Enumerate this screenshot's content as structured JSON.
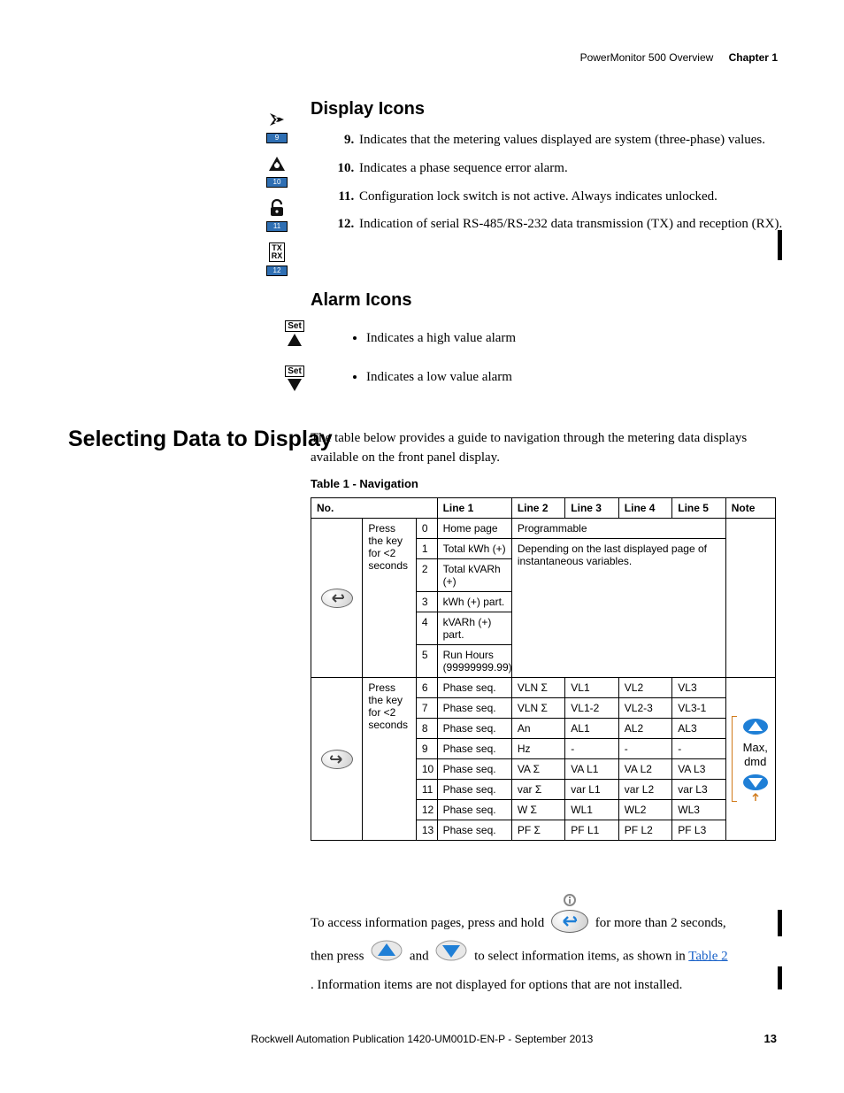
{
  "header": {
    "doc_title": "PowerMonitor 500 Overview",
    "chapter": "Chapter 1"
  },
  "headings": {
    "display_icons": "Display Icons",
    "alarm_icons": "Alarm Icons",
    "selecting": "Selecting Data to Display",
    "table_caption": "Table 1 - Navigation"
  },
  "icon_refs": {
    "n9": "9",
    "n10": "10",
    "n11": "11",
    "n12": "12",
    "tx": "TX",
    "rx": "RX"
  },
  "display_list": {
    "start": 9,
    "items": [
      "Indicates that the metering values displayed are system (three-phase) values.",
      "Indicates a phase sequence error alarm.",
      "Configuration lock switch is not active. Always indicates unlocked.",
      "Indication of serial RS-485/RS-232 data transmission (TX) and reception (RX)."
    ]
  },
  "alarm_set_label": "Set",
  "alarm_list": [
    "Indicates a high value alarm",
    "Indicates a low value alarm"
  ],
  "intro_para": "The table below provides a guide to navigation through the metering data displays available on the front panel display.",
  "table": {
    "headers": {
      "no": "No.",
      "l1": "Line 1",
      "l2": "Line 2",
      "l3": "Line 3",
      "l4": "Line 4",
      "l5": "Line 5",
      "note": "Note"
    },
    "block_a": {
      "press": "Press the key for <2 seconds",
      "rows": [
        {
          "no": "0",
          "l1": "Home page",
          "span": "Programmable",
          "span_cols": 4
        },
        {
          "no": "1",
          "l1": "Total kWh (+)",
          "depending": true
        },
        {
          "no": "2",
          "l1": "Total kVARh (+)",
          "depending": true
        },
        {
          "no": "3",
          "l1": "kWh (+) part.",
          "depending": true
        },
        {
          "no": "4",
          "l1": "kVARh (+) part.",
          "depending": true
        },
        {
          "no": "5",
          "l1": "Run Hours (99999999.99)",
          "depending": true
        }
      ],
      "depending_text": "Depending on the last displayed page of instantaneous variables."
    },
    "block_b": {
      "press": "Press the key for <2 seconds",
      "note_text": "Max, dmd",
      "rows": [
        {
          "no": "6",
          "l1": "Phase seq.",
          "l2": "VLN Σ",
          "l3": "VL1",
          "l4": "VL2",
          "l5": "VL3"
        },
        {
          "no": "7",
          "l1": "Phase seq.",
          "l2": "VLN Σ",
          "l3": "VL1-2",
          "l4": "VL2-3",
          "l5": "VL3-1"
        },
        {
          "no": "8",
          "l1": "Phase seq.",
          "l2": "An",
          "l3": "AL1",
          "l4": "AL2",
          "l5": "AL3"
        },
        {
          "no": "9",
          "l1": "Phase seq.",
          "l2": "Hz",
          "l3": "-",
          "l4": "-",
          "l5": "-"
        },
        {
          "no": "10",
          "l1": "Phase seq.",
          "l2": "VA Σ",
          "l3": "VA L1",
          "l4": "VA L2",
          "l5": "VA L3"
        },
        {
          "no": "11",
          "l1": "Phase seq.",
          "l2": "var Σ",
          "l3": "var L1",
          "l4": "var L2",
          "l5": "var L3"
        },
        {
          "no": "12",
          "l1": "Phase seq.",
          "l2": "W Σ",
          "l3": "WL1",
          "l4": "WL2",
          "l5": "WL3"
        },
        {
          "no": "13",
          "l1": "Phase seq.",
          "l2": "PF Σ",
          "l3": "PF L1",
          "l4": "PF L2",
          "l5": "PF L3"
        }
      ]
    }
  },
  "info": {
    "part1": "To access information pages, press and hold",
    "part2": "for more than 2 seconds,",
    "part3": "then press",
    "part4": "and",
    "part5": "to select information items, as shown in",
    "link": "Table 2",
    "part6": ". Information items are not displayed for options that are not installed."
  },
  "footer": {
    "pub": "Rockwell Automation Publication 1420-UM001D-EN-P - September 2013",
    "page": "13"
  }
}
